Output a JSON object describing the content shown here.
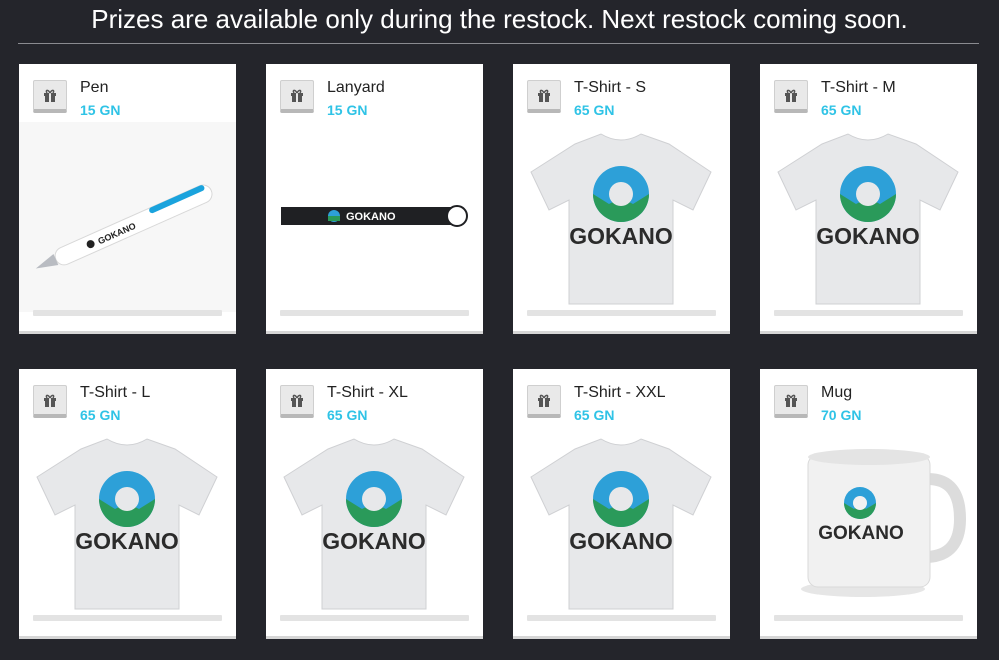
{
  "banner": "Prizes are available only during the restock. Next restock coming soon.",
  "brand": "GOKANO",
  "colors": {
    "background": "#24252b",
    "price": "#2fc3e6",
    "logo_blue": "#2da0d8",
    "logo_green": "#2a9a5a"
  },
  "prizes": [
    {
      "name": "Pen",
      "price": "15 GN",
      "icon": "gift-icon",
      "image": "pen"
    },
    {
      "name": "Lanyard",
      "price": "15 GN",
      "icon": "gift-icon",
      "image": "lanyard"
    },
    {
      "name": "T-Shirt - S",
      "price": "65 GN",
      "icon": "gift-icon",
      "image": "tshirt"
    },
    {
      "name": "T-Shirt - M",
      "price": "65 GN",
      "icon": "gift-icon",
      "image": "tshirt"
    },
    {
      "name": "T-Shirt - L",
      "price": "65 GN",
      "icon": "gift-icon",
      "image": "tshirt"
    },
    {
      "name": "T-Shirt - XL",
      "price": "65 GN",
      "icon": "gift-icon",
      "image": "tshirt"
    },
    {
      "name": "T-Shirt - XXL",
      "price": "65 GN",
      "icon": "gift-icon",
      "image": "tshirt"
    },
    {
      "name": "Mug",
      "price": "70 GN",
      "icon": "gift-icon",
      "image": "mug"
    }
  ]
}
